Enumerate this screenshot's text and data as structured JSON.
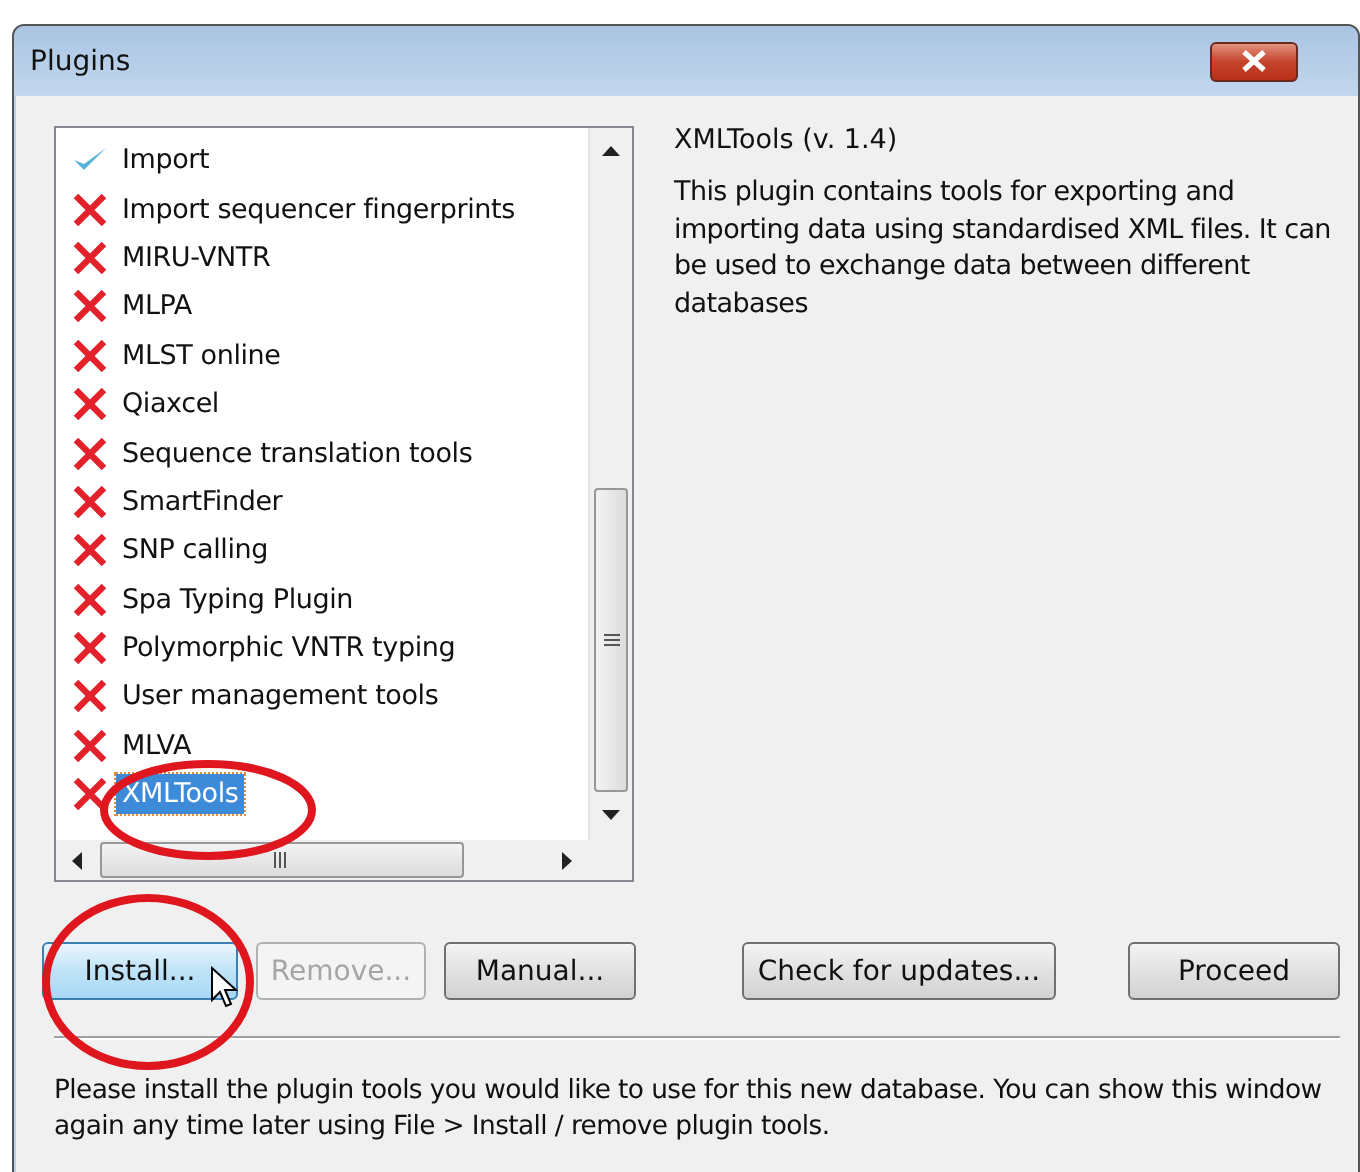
{
  "window": {
    "title": "Plugins"
  },
  "plugins": [
    {
      "name": "Import",
      "installed": true,
      "selected": false
    },
    {
      "name": "Import sequencer fingerprints",
      "installed": false,
      "selected": false
    },
    {
      "name": "MIRU-VNTR",
      "installed": false,
      "selected": false
    },
    {
      "name": "MLPA",
      "installed": false,
      "selected": false
    },
    {
      "name": "MLST online",
      "installed": false,
      "selected": false
    },
    {
      "name": "Qiaxcel",
      "installed": false,
      "selected": false
    },
    {
      "name": "Sequence translation tools",
      "installed": false,
      "selected": false
    },
    {
      "name": "SmartFinder",
      "installed": false,
      "selected": false
    },
    {
      "name": "SNP calling",
      "installed": false,
      "selected": false
    },
    {
      "name": "Spa Typing Plugin",
      "installed": false,
      "selected": false
    },
    {
      "name": "Polymorphic VNTR typing",
      "installed": false,
      "selected": false
    },
    {
      "name": "User management tools",
      "installed": false,
      "selected": false
    },
    {
      "name": "MLVA",
      "installed": false,
      "selected": false
    },
    {
      "name": "XMLTools",
      "installed": false,
      "selected": true
    }
  ],
  "details": {
    "title": "XMLTools (v. 1.4)",
    "description": "This plugin contains tools for exporting and importing data using standardised XML files. It can be used to exchange data between different databases"
  },
  "buttons": [
    {
      "label": "Install...",
      "disabled": false,
      "hovered": true
    },
    {
      "label": "Remove...",
      "disabled": true,
      "hovered": false
    },
    {
      "label": "Manual...",
      "disabled": false,
      "hovered": false
    },
    {
      "label": "Check for updates...",
      "disabled": false,
      "hovered": false
    },
    {
      "label": "Proceed",
      "disabled": false,
      "hovered": false
    }
  ],
  "footer": "Please install the plugin tools you would like to use for this new database. You can show this window again any time later using File > Install / remove plugin tools."
}
